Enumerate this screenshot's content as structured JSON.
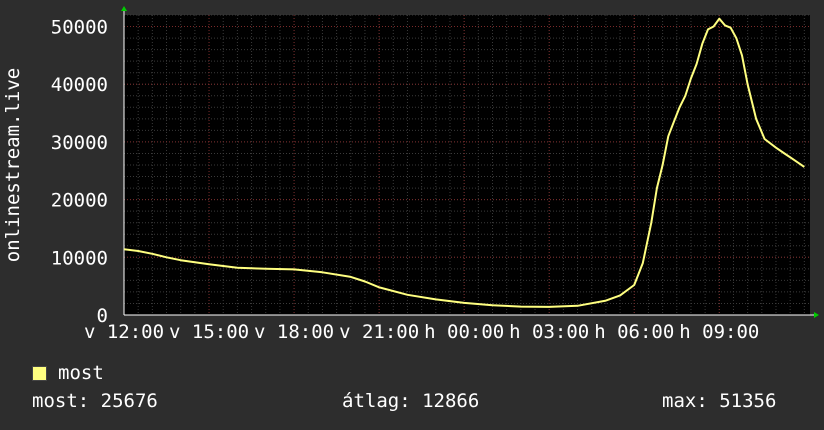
{
  "colors": {
    "background": "#2d2d2d",
    "plot_background": "#000000",
    "grid_minor": "#3a3a3a",
    "grid_major": "#7a2a2a",
    "series": "#ffff80",
    "text": "#ffffff",
    "axis_arrow": "#00cc00"
  },
  "chart_data": {
    "type": "line",
    "title": "",
    "xlabel": "",
    "ylabel": "onlinestream.live",
    "ylim": [
      0,
      52000
    ],
    "y_ticks": [
      0,
      10000,
      20000,
      30000,
      40000,
      50000
    ],
    "y_tick_labels": [
      "0",
      "10000",
      "20000",
      "30000",
      "40000",
      "50000"
    ],
    "x_tick_labels": [
      "v 12:00",
      "v 15:00",
      "v 18:00",
      "v 21:00",
      "h 00:00",
      "h 03:00",
      "h 06:00",
      "h 09:00"
    ],
    "x_tick_hours": [
      0,
      3,
      6,
      9,
      12,
      15,
      18,
      21
    ],
    "x_range_hours": [
      0,
      24.2
    ],
    "grid": true,
    "legend_position": "bottom-left",
    "series": [
      {
        "name": "most",
        "x_hours": [
          0,
          0.5,
          1,
          1.5,
          2,
          3,
          4,
          5,
          6,
          7,
          8,
          8.5,
          9,
          10,
          11,
          12,
          13,
          14,
          15,
          16,
          17,
          17.5,
          18,
          18.3,
          18.6,
          18.8,
          19,
          19.2,
          19.4,
          19.6,
          19.8,
          20,
          20.2,
          20.4,
          20.6,
          20.8,
          21,
          21.2,
          21.4,
          21.6,
          21.8,
          22,
          22.3,
          22.6,
          23,
          23.3,
          23.6,
          24
        ],
        "values": [
          11400,
          11100,
          10600,
          10000,
          9500,
          8800,
          8200,
          8000,
          7900,
          7400,
          6600,
          5800,
          4800,
          3500,
          2700,
          2100,
          1700,
          1450,
          1400,
          1600,
          2500,
          3400,
          5200,
          9000,
          16000,
          22000,
          26000,
          31000,
          33500,
          36000,
          38000,
          41000,
          43500,
          47000,
          49500,
          50000,
          51356,
          50200,
          49800,
          48000,
          45000,
          40000,
          34000,
          30500,
          29000,
          28000,
          27000,
          25676
        ]
      }
    ],
    "legend": [
      {
        "name": "most",
        "color": "#ffff80"
      }
    ]
  },
  "stats": {
    "current_label": "most:",
    "current_value": "25676",
    "avg_label": "átlag:",
    "avg_value": "12866",
    "max_label": "max:",
    "max_value": "51356"
  }
}
